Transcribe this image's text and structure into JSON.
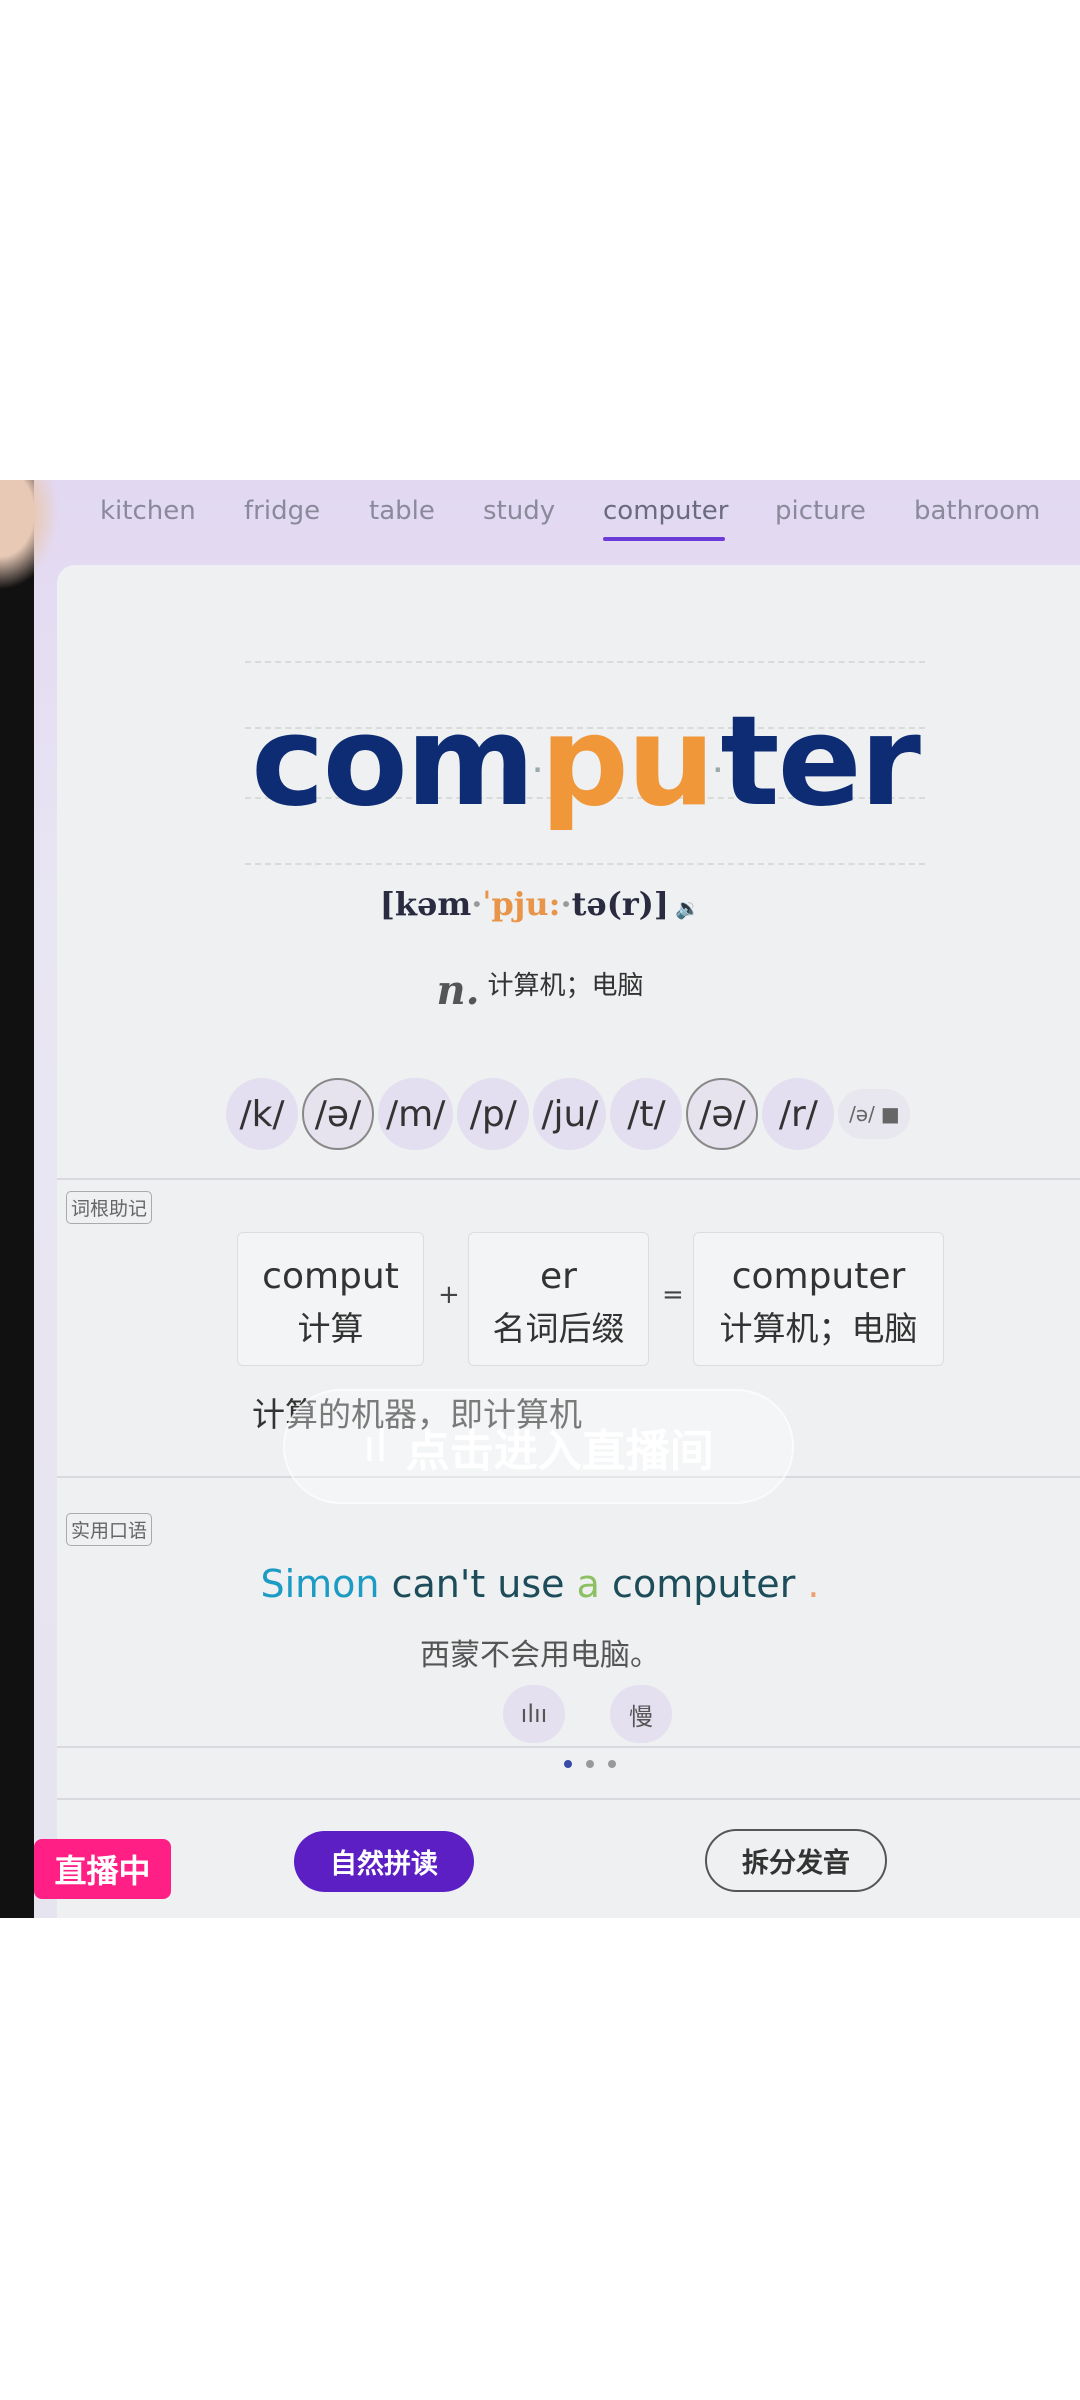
{
  "tabs": [
    {
      "label": "kitchen"
    },
    {
      "label": "fridge"
    },
    {
      "label": "table"
    },
    {
      "label": "study"
    },
    {
      "label": "computer",
      "active": true
    },
    {
      "label": "picture"
    },
    {
      "label": "bathroom"
    }
  ],
  "word": {
    "part1": "com",
    "part2": "pu",
    "part3": "ter",
    "syllable_dot": "·"
  },
  "ipa": {
    "open": "[kəm",
    "stress": "ˈpju:",
    "rest": "tə(r)]",
    "separator": "·"
  },
  "definition": {
    "pos": "n.",
    "meaning": "计算机；电脑"
  },
  "phonemes": [
    "/k/",
    "/ə/",
    "/m/",
    "/p/",
    "/ju/",
    "/t/",
    "/ə/",
    "/r/"
  ],
  "phoneme_extra": "/ə/",
  "root_section": {
    "tag": "词根助记",
    "parts": [
      {
        "en": "comput",
        "zh": "计算"
      },
      {
        "en": "er",
        "zh": "名词后缀"
      },
      {
        "en": "computer",
        "zh": "计算机；电脑"
      }
    ],
    "plus": "+",
    "equals": "=",
    "explanation": "计算的机器，即计算机"
  },
  "live_overlay": {
    "label": "点击进入直播间"
  },
  "phrase_section": {
    "tag": "实用口语",
    "sentence": {
      "w1": "Simon",
      "w2": "can't use",
      "w3": "a",
      "w4": "computer",
      "w5": "."
    },
    "translation": "西蒙不会用电脑。",
    "slow_label": "慢"
  },
  "buttons": {
    "phonics": "自然拼读",
    "split": "拆分发音"
  },
  "live_badge": "直播中",
  "colors": {
    "accent": "#5b1fc4",
    "word": "#0d2c74",
    "highlight": "#f0973a",
    "live": "#ff1f85"
  }
}
